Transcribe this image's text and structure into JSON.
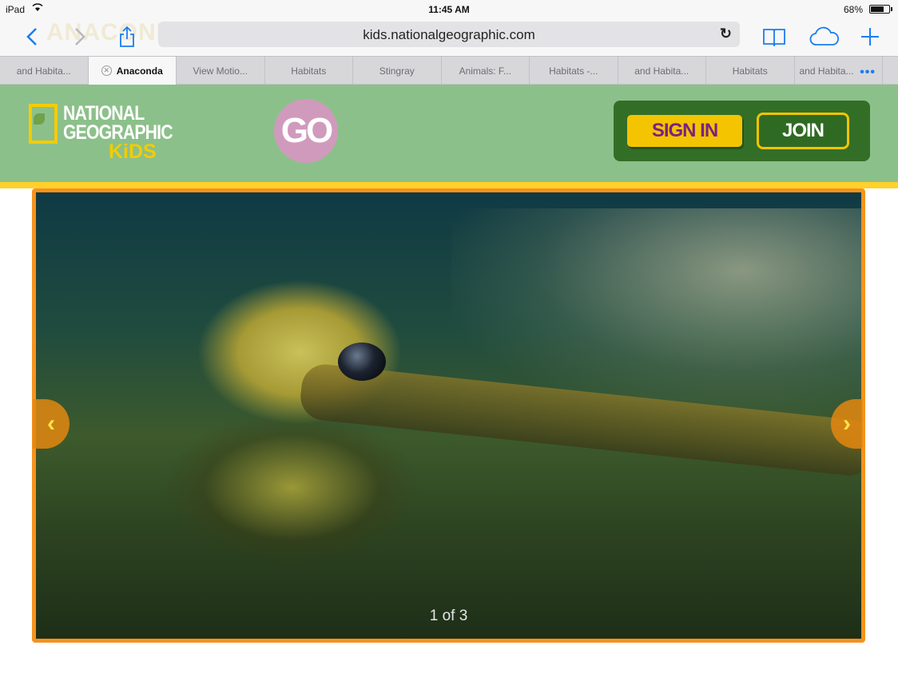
{
  "status_bar": {
    "device": "iPad",
    "time": "11:45 AM",
    "battery": "68%"
  },
  "toolbar": {
    "url": "kids.nationalgeographic.com",
    "ghost_title": "ANACONDA"
  },
  "tabs": [
    {
      "label": "and Habita..."
    },
    {
      "label": "Anaconda"
    },
    {
      "label": "View Motio..."
    },
    {
      "label": "Habitats"
    },
    {
      "label": "Stingray"
    },
    {
      "label": "Animals: F..."
    },
    {
      "label": "Habitats -..."
    },
    {
      "label": "and Habita..."
    },
    {
      "label": "Habitats"
    },
    {
      "label": "and Habita..."
    }
  ],
  "header": {
    "logo_line1": "NATIONAL",
    "logo_line2": "GEOGRAPHIC",
    "logo_line3": "KiDS",
    "go_label": "GO",
    "sign_in_label": "SIGN IN",
    "join_label": "JOIN"
  },
  "hero": {
    "counter": "1 of 3",
    "prev_glyph": "‹",
    "next_glyph": "›"
  },
  "colors": {
    "header_green": "#8cc08a",
    "auth_green": "#336e27",
    "accent_yellow": "#f4c400",
    "frame_orange": "#f6921e",
    "link_blue": "#1a7cf4"
  }
}
